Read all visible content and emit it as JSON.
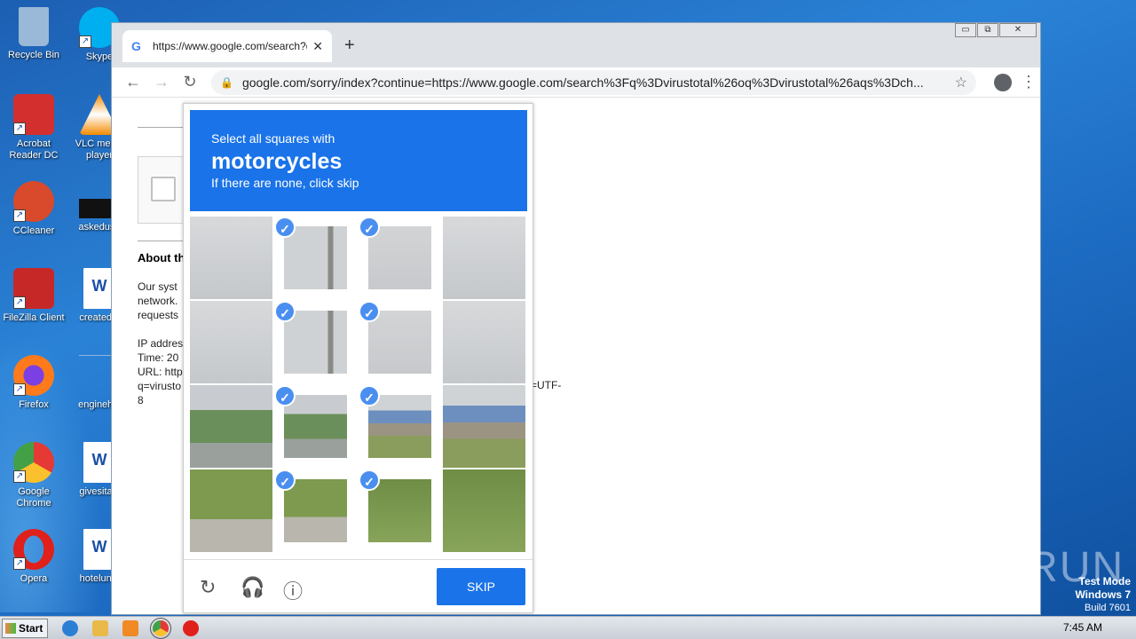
{
  "desktop": {
    "icons": [
      {
        "label": "Recycle Bin",
        "icon": "recycle-bin-icon",
        "color": "#9ab8d8"
      },
      {
        "label": "Acrobat Reader DC",
        "icon": "acrobat-icon",
        "color": "#d32f2f"
      },
      {
        "label": "CCleaner",
        "icon": "ccleaner-icon",
        "color": "#d84a2b"
      },
      {
        "label": "FileZilla Client",
        "icon": "filezilla-icon",
        "color": "#c62828"
      },
      {
        "label": "Firefox",
        "icon": "firefox-icon",
        "color": "#ff7a1a"
      },
      {
        "label": "Google Chrome",
        "icon": "chrome-icon",
        "color": "#4caf50"
      },
      {
        "label": "Opera",
        "icon": "opera-icon",
        "color": "#e0201b"
      },
      {
        "label": "Skype",
        "icon": "skype-icon",
        "color": "#00aff0"
      },
      {
        "label": "VLC media player",
        "icon": "vlc-icon",
        "color": "#f48b00"
      },
      {
        "label": "askeduse",
        "icon": "file-icon",
        "color": "#111111"
      },
      {
        "label": "createddi",
        "icon": "word-doc-icon",
        "color": "#ffffff"
      },
      {
        "label": "enginehig",
        "icon": "file-icon",
        "color": "#1d6cc3"
      },
      {
        "label": "givesitaly",
        "icon": "word-doc-icon",
        "color": "#ffffff"
      },
      {
        "label": "hotelundi",
        "icon": "word-doc-icon",
        "color": "#ffffff"
      }
    ]
  },
  "browser": {
    "tab_title": "https://www.google.com/search?q=",
    "tab_favicon": "G",
    "new_tab": "+",
    "url": "google.com/sorry/index?continue=https://www.google.com/search%3Fq%3Dvirustotal%26oq%3Dvirustotal%26aqs%3Dch...",
    "nav_back": "←",
    "nav_forward": "→",
    "nav_reload": "↻",
    "lock": "🔒",
    "star": "☆",
    "menu": "⋮",
    "win_min": "▭",
    "win_max": "⧉",
    "win_close": "✕"
  },
  "page": {
    "about_heading": "About th",
    "para1": [
      "Our syst",
      "network.",
      "requests"
    ],
    "para2": [
      "IP addres",
      "Time: 20",
      "URL: http",
      "q=virusto",
      "8"
    ],
    "url_tail": "=UTF-"
  },
  "captcha": {
    "instruction": "Select all squares with",
    "target": "motorcycles",
    "hint": "If there are none, click skip",
    "accent_color": "#1a73e8",
    "tiles": [
      {
        "scene": "sky",
        "selected": false
      },
      {
        "scene": "sky-pole",
        "selected": true
      },
      {
        "scene": "light",
        "selected": true
      },
      {
        "scene": "sky",
        "selected": false
      },
      {
        "scene": "sky",
        "selected": false
      },
      {
        "scene": "sky-pole",
        "selected": true
      },
      {
        "scene": "light",
        "selected": true
      },
      {
        "scene": "sky",
        "selected": false
      },
      {
        "scene": "street",
        "selected": false
      },
      {
        "scene": "street",
        "selected": true
      },
      {
        "scene": "shop",
        "selected": true
      },
      {
        "scene": "shop",
        "selected": false
      },
      {
        "scene": "grass",
        "selected": false
      },
      {
        "scene": "grass",
        "selected": true
      },
      {
        "scene": "grass2",
        "selected": true
      },
      {
        "scene": "grass2",
        "selected": false
      }
    ],
    "check_glyph": "✓",
    "reload_icon": "↻",
    "audio_icon": "🎧",
    "info_icon": "ⓘ",
    "skip_label": "SKIP"
  },
  "watermark": "ANY RUN",
  "test_mode": {
    "line1": "Test Mode",
    "line2": "Windows 7",
    "line3": "Build 7601"
  },
  "taskbar": {
    "start_label": "Start",
    "clock": "7:45 AM",
    "pinned": [
      {
        "icon": "ie-icon",
        "color": "#2b7fd3"
      },
      {
        "icon": "explorer-icon",
        "color": "#e9b949"
      },
      {
        "icon": "media-player-icon",
        "color": "#f08a24"
      },
      {
        "icon": "chrome-icon",
        "color": "#4caf50",
        "active": true
      },
      {
        "icon": "opera-icon",
        "color": "#e0201b"
      }
    ]
  }
}
